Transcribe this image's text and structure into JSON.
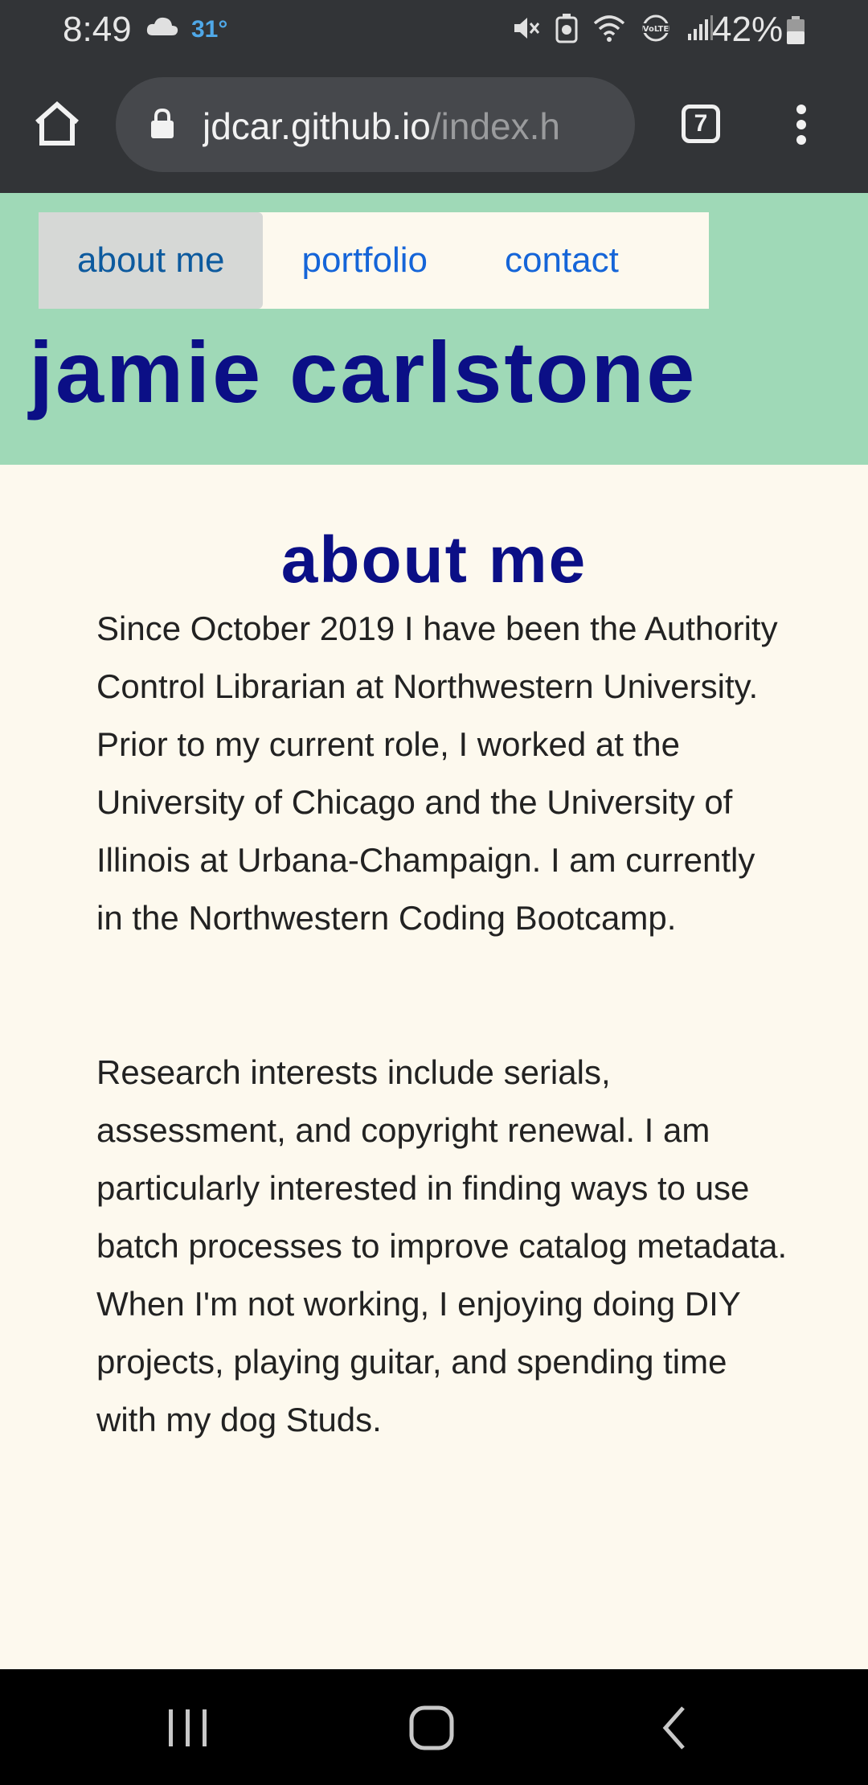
{
  "status_bar": {
    "time": "8:49",
    "temperature": "31°",
    "battery_percent": "42%"
  },
  "browser": {
    "url_domain": "jdcar.github.io",
    "url_path": "/index.h",
    "tab_count": "7"
  },
  "nav": {
    "items": [
      {
        "label": "about me",
        "active": true
      },
      {
        "label": "portfolio",
        "active": false
      },
      {
        "label": "contact",
        "active": false
      }
    ]
  },
  "site": {
    "title": "jamie carlstone"
  },
  "main": {
    "heading": "about me",
    "paragraphs": [
      "Since October 2019 I have been the Authority Control Librarian at Northwestern University. Prior to my current role, I worked at the University of Chicago and the University of Illinois at Urbana-Champaign. I am currently in the Northwestern Coding Bootcamp.",
      "Research interests include serials, assessment, and copyright renewal. I am particularly interested in finding ways to use batch processes to improve catalog metadata. When I'm not working, I enjoying doing DIY projects, playing guitar, and spending time with my dog Studs."
    ]
  },
  "colors": {
    "header_bg": "#9fd9b7",
    "page_bg": "#fdf9ee",
    "title_color": "#0b0f86",
    "link_color": "#1565d8",
    "chrome_bg": "#323437"
  }
}
